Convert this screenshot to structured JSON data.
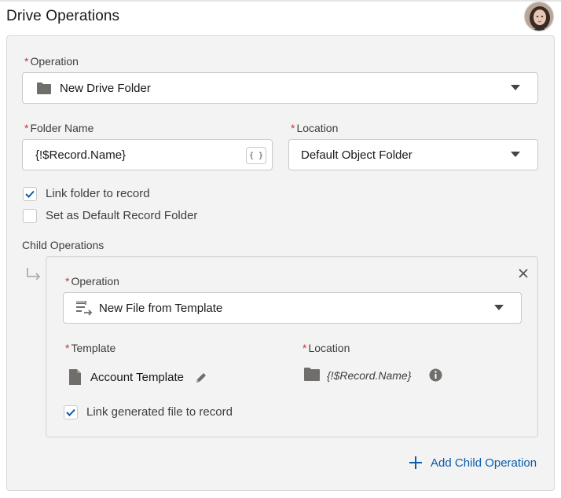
{
  "page": {
    "title": "Drive Operations"
  },
  "operation": {
    "required_mark": "*",
    "label": "Operation",
    "value": "New Drive Folder",
    "icon": "folder-icon"
  },
  "folder_name": {
    "required_mark": "*",
    "label": "Folder Name",
    "value": "{!$Record.Name}",
    "merge_button": "{ }"
  },
  "location": {
    "required_mark": "*",
    "label": "Location",
    "value": "Default Object Folder"
  },
  "checkboxes": {
    "link_folder": {
      "label": "Link folder to record",
      "checked": true
    },
    "default_folder": {
      "label": "Set as Default Record Folder",
      "checked": false
    }
  },
  "child_operations": {
    "label": "Child Operations",
    "operation": {
      "required_mark": "*",
      "label": "Operation",
      "value": "New File from Template",
      "icon": "file-template-icon"
    },
    "template": {
      "required_mark": "*",
      "label": "Template",
      "value": "Account Template"
    },
    "location": {
      "required_mark": "*",
      "label": "Location",
      "value": "{!$Record.Name}"
    },
    "link_file": {
      "label": "Link generated file to record",
      "checked": true
    }
  },
  "add_child": {
    "label": "Add Child Operation"
  },
  "colors": {
    "accent": "#0b5cab",
    "required": "#c23934",
    "panel": "#f3f3f3"
  }
}
